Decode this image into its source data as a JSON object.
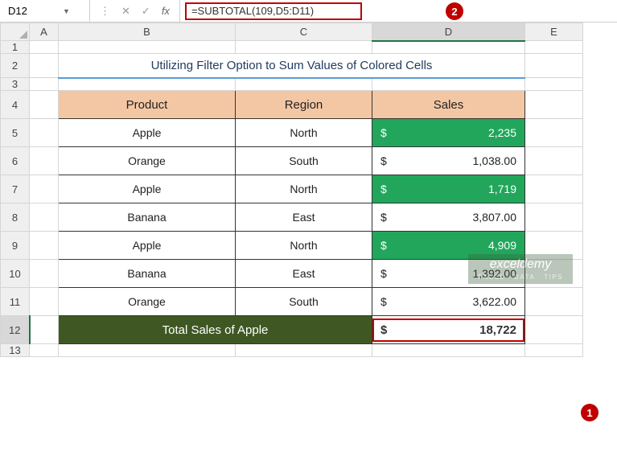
{
  "active_cell": "D12",
  "formula": "=SUBTOTAL(109,D5:D11)",
  "callouts": {
    "one": "1",
    "two": "2"
  },
  "columns": [
    "A",
    "B",
    "C",
    "D",
    "E"
  ],
  "rows": [
    "1",
    "2",
    "3",
    "4",
    "5",
    "6",
    "7",
    "8",
    "9",
    "10",
    "11",
    "12",
    "13"
  ],
  "title": "Utilizing Filter Option to Sum Values of Colored Cells",
  "headers": {
    "product": "Product",
    "region": "Region",
    "sales": "Sales"
  },
  "data": [
    {
      "product": "Apple",
      "region": "North",
      "currency": "$",
      "sales": "2,235",
      "colored": true
    },
    {
      "product": "Orange",
      "region": "South",
      "currency": "$",
      "sales": "1,038.00",
      "colored": false
    },
    {
      "product": "Apple",
      "region": "North",
      "currency": "$",
      "sales": "1,719",
      "colored": true
    },
    {
      "product": "Banana",
      "region": "East",
      "currency": "$",
      "sales": "3,807.00",
      "colored": false
    },
    {
      "product": "Apple",
      "region": "North",
      "currency": "$",
      "sales": "4,909",
      "colored": true
    },
    {
      "product": "Banana",
      "region": "East",
      "currency": "$",
      "sales": "1,392.00",
      "colored": false
    },
    {
      "product": "Orange",
      "region": "South",
      "currency": "$",
      "sales": "3,622.00",
      "colored": false
    }
  ],
  "total": {
    "label": "Total Sales of Apple",
    "currency": "$",
    "value": "18,722"
  },
  "watermark": {
    "top": "exceldemy",
    "bottom": "EXCEL · DATA · TIPS"
  },
  "chart_data": {
    "type": "table",
    "title": "Utilizing Filter Option to Sum Values of Colored Cells",
    "columns": [
      "Product",
      "Region",
      "Sales"
    ],
    "rows": [
      [
        "Apple",
        "North",
        2235
      ],
      [
        "Orange",
        "South",
        1038.0
      ],
      [
        "Apple",
        "North",
        1719
      ],
      [
        "Banana",
        "East",
        3807.0
      ],
      [
        "Apple",
        "North",
        4909
      ],
      [
        "Banana",
        "East",
        1392.0
      ],
      [
        "Orange",
        "South",
        3622.0
      ]
    ],
    "totals": {
      "label": "Total Sales of Apple",
      "value": 18722
    },
    "formula": "=SUBTOTAL(109,D5:D11)"
  }
}
